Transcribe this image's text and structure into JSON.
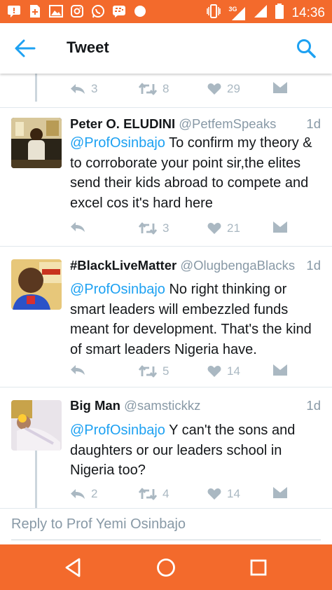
{
  "status_bar": {
    "time": "14:36",
    "network": "3G",
    "left_icons": [
      "message-icon",
      "sim-icon",
      "gallery-icon",
      "instagram-icon",
      "whatsapp-icon",
      "bbm-icon",
      "dot-icon"
    ]
  },
  "app_bar": {
    "title": "Tweet",
    "back_icon": "arrow-left-icon",
    "search_icon": "search-icon"
  },
  "colors": {
    "system_bar": "#f36a2c",
    "accent": "#1da1f2",
    "muted": "#8899a6",
    "icon_muted": "#aab8c2"
  },
  "top_actions": {
    "reply_count": "3",
    "retweet_count": "8",
    "like_count": "29"
  },
  "tweets": [
    {
      "name": "Peter O. ELUDINI",
      "handle": "@PetfemSpeaks",
      "time": "1d",
      "mention": "@ProfOsinbajo",
      "text": " To confirm my theory & to corroborate your point sir,the elites send their kids abroad to compete and excel cos it's hard here",
      "reply_count": "",
      "retweet_count": "3",
      "like_count": "21"
    },
    {
      "name": "#BlackLiveMatter",
      "handle": "@OlugbengaBlacks",
      "time": "1d",
      "mention": "@ProfOsinbajo",
      "text": " No right thinking or smart leaders will embezzled funds meant for development. That's the kind of smart leaders Nigeria have.",
      "reply_count": "",
      "retweet_count": "5",
      "like_count": "14"
    },
    {
      "name": "Big Man",
      "handle": "@samstickkz",
      "time": "1d",
      "mention": "@ProfOsinbajo",
      "text": " Y can't the sons and daughters or our leaders school in Nigeria too?",
      "reply_count": "2",
      "retweet_count": "4",
      "like_count": "14"
    }
  ],
  "reply_box": {
    "placeholder": "Reply to Prof Yemi Osinbajo"
  },
  "nav_bar": {
    "back": "triangle-back-icon",
    "home": "circle-home-icon",
    "recents": "square-recents-icon"
  }
}
